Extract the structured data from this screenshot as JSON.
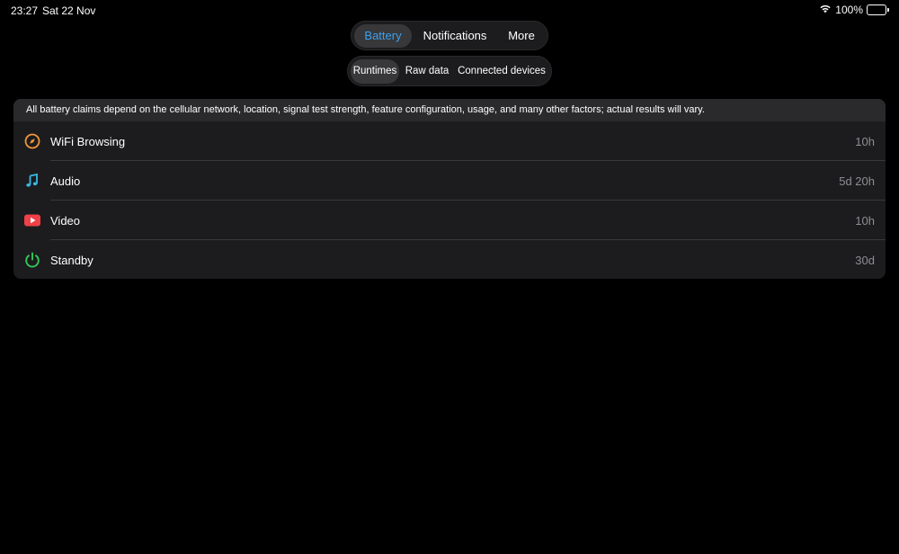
{
  "status_bar": {
    "time": "23:27",
    "date": "Sat 22 Nov",
    "battery_percent": "100%",
    "wifi_icon": "wifi-icon",
    "battery_icon": "battery-full-icon"
  },
  "main_tabs": {
    "selected": "Battery",
    "items": [
      {
        "label": "Battery"
      },
      {
        "label": "Notifications"
      },
      {
        "label": "More"
      }
    ]
  },
  "sub_tabs": {
    "selected": "Runtimes",
    "items": [
      {
        "label": "Runtimes"
      },
      {
        "label": "Raw data"
      },
      {
        "label": "Connected devices"
      }
    ]
  },
  "card": {
    "disclaimer": "All battery claims depend on the cellular network, location, signal test strength, feature configuration, usage, and many other factors; actual results will vary.",
    "rows": [
      {
        "label": "WiFi Browsing",
        "value": "10h",
        "icon": "compass-icon",
        "icon_color": "#f0963a"
      },
      {
        "label": "Audio",
        "value": "5d 20h",
        "icon": "music-note-icon",
        "icon_color": "#3ab8e6"
      },
      {
        "label": "Video",
        "value": "10h",
        "icon": "play-icon",
        "icon_color": "#f04048"
      },
      {
        "label": "Standby",
        "value": "30d",
        "icon": "power-icon",
        "icon_color": "#34c759"
      }
    ]
  },
  "colors": {
    "accent": "#3aa0f0",
    "background": "#000000",
    "card": "#1c1c1e"
  }
}
